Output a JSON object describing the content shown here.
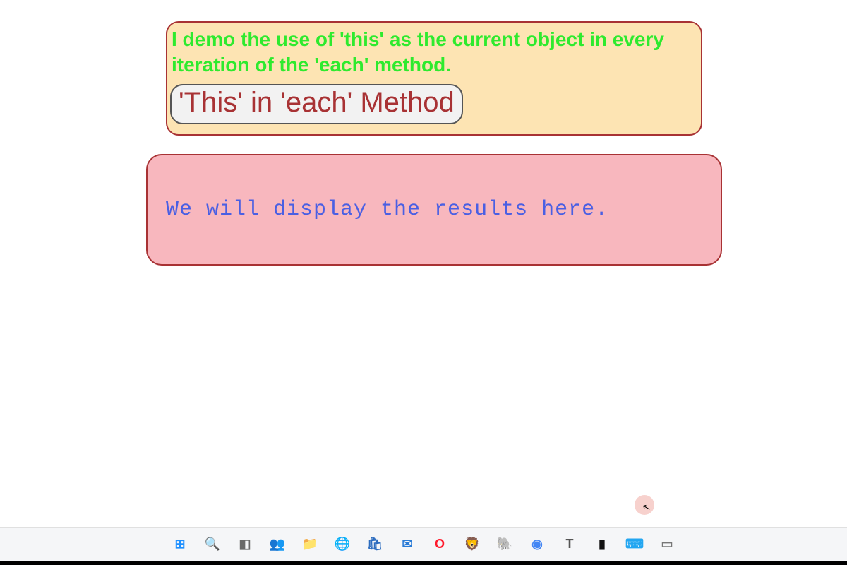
{
  "card1": {
    "intro": "I demo the use of 'this' as the current object in every iteration of the 'each' method.",
    "button_label": "'This' in 'each' Method"
  },
  "card2": {
    "results_text": "We will display the results here."
  },
  "taskbar": {
    "items": [
      {
        "name": "start-icon",
        "glyph": "⊞",
        "color": "#1e90ff"
      },
      {
        "name": "search-icon",
        "glyph": "🔍",
        "color": "#222"
      },
      {
        "name": "taskview-icon",
        "glyph": "◧",
        "color": "#6a6a6a"
      },
      {
        "name": "teams-icon",
        "glyph": "👥",
        "color": "#5059c9"
      },
      {
        "name": "explorer-icon",
        "glyph": "📁",
        "color": "#f6c142"
      },
      {
        "name": "edge-icon",
        "glyph": "🌐",
        "color": "#0a84d1"
      },
      {
        "name": "store-icon",
        "glyph": "🛍",
        "color": "#2c6cbf"
      },
      {
        "name": "mail-icon",
        "glyph": "✉",
        "color": "#2a7bd6"
      },
      {
        "name": "opera-icon",
        "glyph": "O",
        "color": "#ff1b2d"
      },
      {
        "name": "brave-icon",
        "glyph": "🦁",
        "color": "#fb542b"
      },
      {
        "name": "evernote-icon",
        "glyph": "🐘",
        "color": "#2dbe60"
      },
      {
        "name": "chrome-icon",
        "glyph": "◉",
        "color": "#4285f4"
      },
      {
        "name": "text-icon",
        "glyph": "T",
        "color": "#555"
      },
      {
        "name": "terminal-icon",
        "glyph": "▮",
        "color": "#111"
      },
      {
        "name": "vscode-icon",
        "glyph": "⌨",
        "color": "#22a6f1"
      },
      {
        "name": "screentogif-icon",
        "glyph": "▭",
        "color": "#777"
      }
    ]
  }
}
